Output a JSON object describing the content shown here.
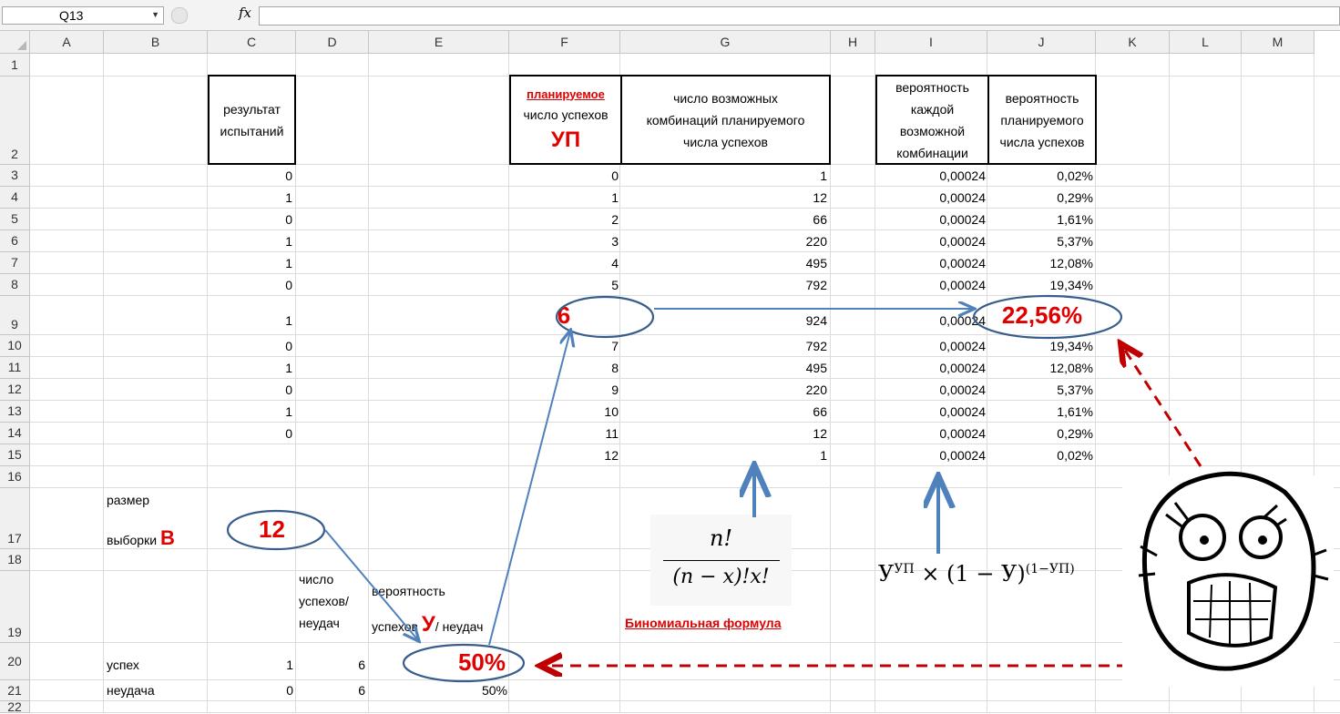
{
  "formula_bar": {
    "name_box": "Q13",
    "fx_label": "fx",
    "content": ""
  },
  "columns": [
    "A",
    "B",
    "C",
    "D",
    "E",
    "F",
    "G",
    "H",
    "I",
    "J",
    "K",
    "L",
    "M"
  ],
  "rows": [
    "1",
    "2",
    "3",
    "4",
    "5",
    "6",
    "7",
    "8",
    "9",
    "10",
    "11",
    "12",
    "13",
    "14",
    "15",
    "16",
    "17",
    "18",
    "19",
    "20",
    "21",
    "22"
  ],
  "headers": {
    "c_line1": "результат",
    "c_line2": "испытаний",
    "f_red": "планируемое",
    "f_line2": "число успехов",
    "f_big": "УП",
    "g_line1": "число возможных",
    "g_line2": "комбинаций планируемого",
    "g_line3": "числа успехов",
    "i_line1": "вероятность",
    "i_line2": "каждой",
    "i_line3": "возможной",
    "i_line4": "комбинации",
    "j_line1": "вероятность",
    "j_line2": "планируемого",
    "j_line3": "числа успехов"
  },
  "col_c": [
    "0",
    "1",
    "0",
    "1",
    "1",
    "0",
    "1",
    "0",
    "1",
    "0",
    "1",
    "0"
  ],
  "col_f": [
    "0",
    "1",
    "2",
    "3",
    "4",
    "5",
    "6",
    "7",
    "8",
    "9",
    "10",
    "11",
    "12"
  ],
  "col_g": [
    "1",
    "12",
    "66",
    "220",
    "495",
    "792",
    "924",
    "792",
    "495",
    "220",
    "66",
    "12",
    "1"
  ],
  "col_i": [
    "0,00024",
    "0,00024",
    "0,00024",
    "0,00024",
    "0,00024",
    "0,00024",
    "0,00024",
    "0,00024",
    "0,00024",
    "0,00024",
    "0,00024",
    "0,00024",
    "0,00024"
  ],
  "col_j": [
    "0,02%",
    "0,29%",
    "1,61%",
    "5,37%",
    "12,08%",
    "19,34%",
    "22,56%",
    "19,34%",
    "12,08%",
    "5,37%",
    "1,61%",
    "0,29%",
    "0,02%"
  ],
  "sample": {
    "label1": "размер",
    "label2": "выборки",
    "letter": "В",
    "value": "12"
  },
  "lower_headers": {
    "d_line1": "число",
    "d_line2": "успехов/",
    "d_line3": "неудач",
    "e_line1": "вероятность",
    "e_line2a": "успехов",
    "e_letter": "У",
    "e_line2b": "/ неудач"
  },
  "outcomes": [
    {
      "label": "успех",
      "c": "1",
      "d": "6",
      "e": "50%"
    },
    {
      "label": "неудача",
      "c": "0",
      "d": "6",
      "e": "50%"
    }
  ],
  "formula": {
    "numerator": "n!",
    "denominator": "(n − x)!x!",
    "caption": "Биномиальная формула"
  },
  "prob_formula": {
    "base": "У",
    "exp1": "УП",
    "times": "× (1 − У)",
    "exp2": "(1−УП)"
  },
  "colors": {
    "arrow_blue": "#4f81bd",
    "ellipse": "#385d8a",
    "red": "#e00000",
    "dark_red": "#c00000"
  }
}
